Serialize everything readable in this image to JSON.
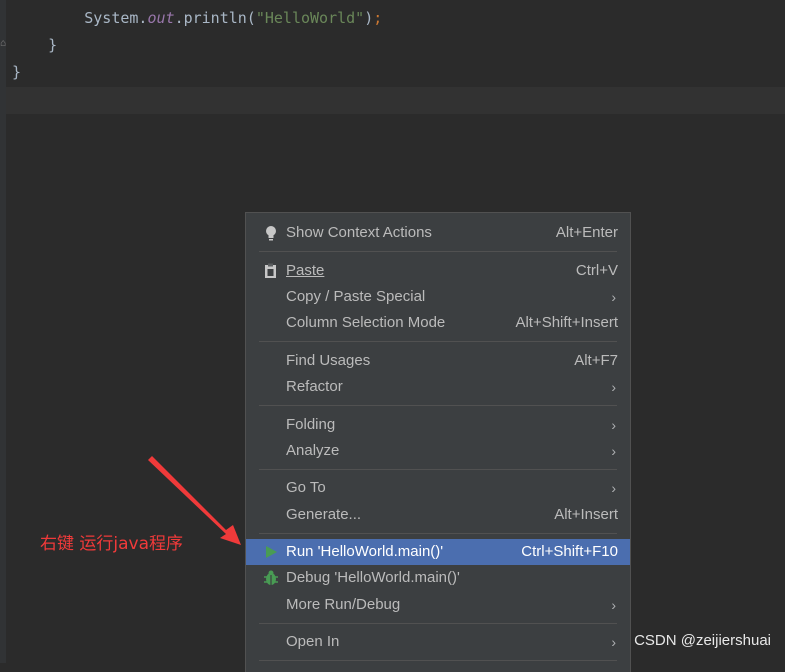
{
  "editor": {
    "lines": [
      {
        "indent": "        ",
        "prefix": "System.",
        "field": "out",
        "method": ".println(",
        "string": "\"HelloWorld\"",
        "end": ")",
        "semi": ";"
      },
      {
        "text": "    }"
      },
      {
        "text": "}"
      }
    ]
  },
  "context_menu": {
    "items": [
      {
        "label": "Show Context Actions",
        "shortcut": "Alt+Enter",
        "icon": "lightbulb-icon"
      },
      {
        "label": "Paste",
        "shortcut": "Ctrl+V",
        "icon": "clipboard-icon"
      },
      {
        "label": "Copy / Paste Special",
        "submenu": "›"
      },
      {
        "label": "Column Selection Mode",
        "shortcut": "Alt+Shift+Insert"
      },
      {
        "label": "Find Usages",
        "shortcut": "Alt+F7"
      },
      {
        "label": "Refactor",
        "submenu": "›"
      },
      {
        "label": "Folding",
        "submenu": "›"
      },
      {
        "label": "Analyze",
        "submenu": "›"
      },
      {
        "label": "Go To",
        "submenu": "›"
      },
      {
        "label": "Generate...",
        "shortcut": "Alt+Insert"
      },
      {
        "label": "Run 'HelloWorld.main()'",
        "shortcut": "Ctrl+Shift+F10",
        "icon": "run-play-icon",
        "selected": true
      },
      {
        "label": "Debug 'HelloWorld.main()'",
        "icon": "debug-bug-icon"
      },
      {
        "label": "More Run/Debug",
        "submenu": "›"
      },
      {
        "label": "Open In",
        "submenu": "›"
      }
    ]
  },
  "annotation": {
    "text": "右键  运行java程序",
    "color": "#f03a3a"
  },
  "watermark": {
    "text": "CSDN @zeijiershuai"
  },
  "colors": {
    "editor_bg": "#2b2b2b",
    "menu_bg": "#3c3f41",
    "selection": "#4b6eaf",
    "run_green": "#499c54"
  }
}
